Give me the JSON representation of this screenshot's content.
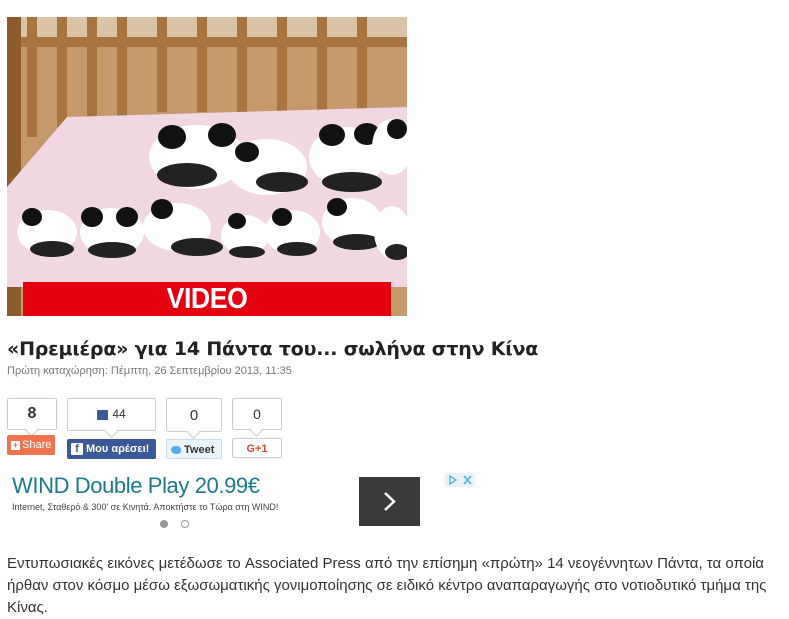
{
  "hero": {
    "banner": "VIDEO"
  },
  "article": {
    "title": "«Πρεμιέρα» για 14 Πάντα του... σωλήνα στην Κίνα",
    "meta": "Πρώτη καταχώρηση: Πέμπτη, 26 Σεπτεμβρίου 2013, 11:35",
    "body": "Εντυπωσιακές εικόνες μετέδωσε το Associated Press από την επίσημη «πρώτη» 14 νεογέννητων Πάντα, τα οποία ήρθαν στον κόσμο μέσω εξωσωματικής γονιμοποίησης σε ειδικό κέντρο αναπαραγωγής στο νοτιοδυτικό τμήμα της Κίνας."
  },
  "social": {
    "share_count": "8",
    "share_label": "Share",
    "like_count": "44",
    "like_label": "Μου αρέσει!",
    "tweet_count": "0",
    "tweet_label": "Tweet",
    "gplus_count": "0",
    "gplus_label": "G+1"
  },
  "ad": {
    "title": "WIND Double Play 20.99€",
    "subtitle": "Internet, Σταθερό & 300' σε Κινητά. Αποκτήστε το Τώρα στη WIND!",
    "colors": {
      "title": "#1a7c8a",
      "button": "#3a3a3a"
    },
    "pager_active": 1,
    "pager_total": 2
  },
  "colors": {
    "video_bar": "#e3000f",
    "share": "#f0734f",
    "facebook": "#3b5998"
  }
}
